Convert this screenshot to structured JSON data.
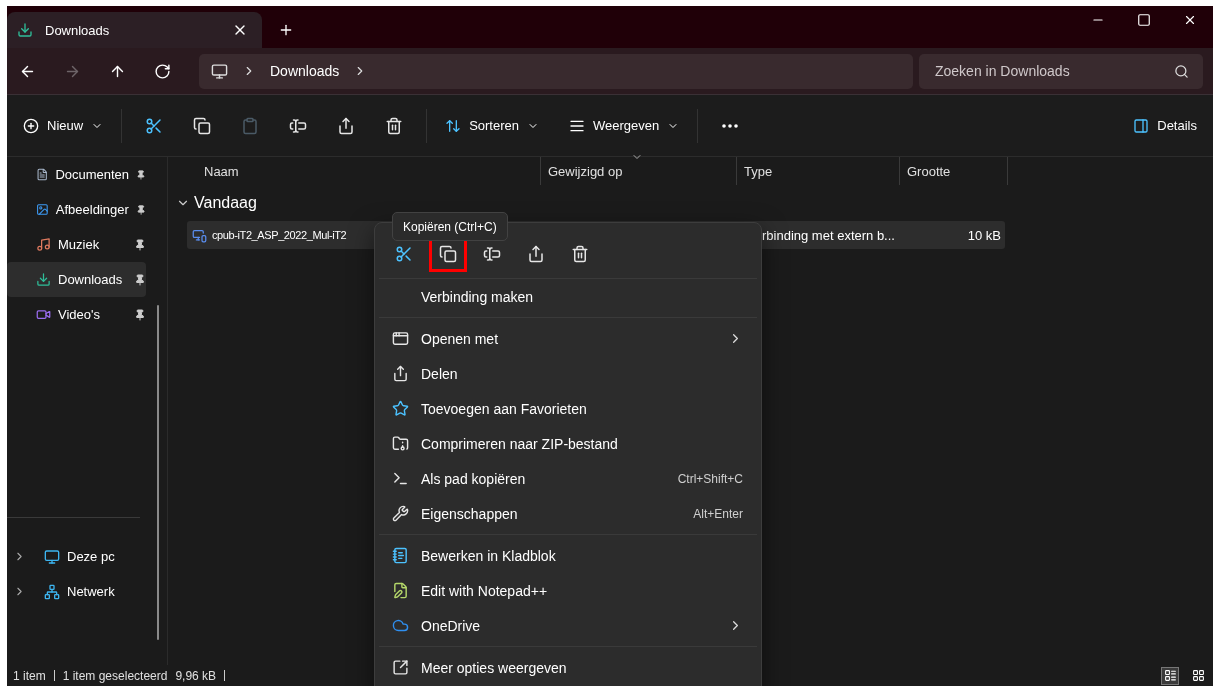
{
  "tab": {
    "title": "Downloads",
    "selected": true
  },
  "window_controls": [
    {
      "kind": "minimize"
    },
    {
      "kind": "maximize"
    },
    {
      "kind": "close"
    }
  ],
  "nav": [
    {
      "kind": "back",
      "disabled": false
    },
    {
      "kind": "forward",
      "disabled": true
    },
    {
      "kind": "up",
      "disabled": false
    },
    {
      "kind": "refresh",
      "disabled": false
    }
  ],
  "address": {
    "crumbs": [
      "Downloads"
    ]
  },
  "search": {
    "placeholder": "Zoeken in Downloads"
  },
  "toolbar": {
    "new_label": "Nieuw",
    "actions": [
      {
        "kind": "cut",
        "disabled": false
      },
      {
        "kind": "copy",
        "disabled": false
      },
      {
        "kind": "paste",
        "disabled": true
      },
      {
        "kind": "rename",
        "disabled": false
      },
      {
        "kind": "share",
        "disabled": false
      },
      {
        "kind": "delete",
        "disabled": false
      }
    ],
    "sort_label": "Sorteren",
    "view_label": "Weergeven",
    "details_label": "Details"
  },
  "sidebar": {
    "items": [
      {
        "label": "Documenten",
        "kind": "documents",
        "pinned": true,
        "selected": false
      },
      {
        "label": "Afbeeldinger",
        "kind": "pictures",
        "pinned": true,
        "selected": false
      },
      {
        "label": "Muziek",
        "kind": "music",
        "pinned": true,
        "selected": false
      },
      {
        "label": "Downloads",
        "kind": "downloads",
        "pinned": true,
        "selected": true
      },
      {
        "label": "Video's",
        "kind": "videos",
        "pinned": true,
        "selected": false
      }
    ],
    "locations": [
      {
        "label": "Deze pc",
        "kind": "pc",
        "expanded": false
      },
      {
        "label": "Netwerk",
        "kind": "network",
        "expanded": false
      }
    ]
  },
  "table": {
    "columns": [
      {
        "label": "Naam",
        "sorted": false
      },
      {
        "label": "Gewijzigd op",
        "sorted": true
      },
      {
        "label": "Type",
        "sorted": false
      },
      {
        "label": "Grootte",
        "sorted": false
      }
    ],
    "groups": [
      {
        "label": "Vandaag",
        "expanded": true,
        "rows": [
          {
            "name": "cpub-iT2_ASP_2022_Mul-iT2",
            "type": "rbinding met extern b...",
            "size": "10 kB",
            "selected": true
          }
        ]
      }
    ]
  },
  "context_menu": {
    "tooltip": "Kopiëren (Ctrl+C)",
    "actions": [
      {
        "kind": "cut",
        "highlighted": false
      },
      {
        "kind": "copy",
        "highlighted": true
      },
      {
        "kind": "rename",
        "highlighted": false
      },
      {
        "kind": "share",
        "highlighted": false
      },
      {
        "kind": "delete",
        "highlighted": false
      }
    ],
    "items": [
      {
        "kind": "plain",
        "label": "Verbinding maken",
        "submenu": false
      },
      {
        "kind": "divider"
      },
      {
        "kind": "open-with",
        "label": "Openen met",
        "submenu": true
      },
      {
        "kind": "share",
        "label": "Delen",
        "submenu": false
      },
      {
        "kind": "favorite",
        "label": "Toevoegen aan Favorieten",
        "submenu": false
      },
      {
        "kind": "zip",
        "label": "Comprimeren naar ZIP-bestand",
        "submenu": false
      },
      {
        "kind": "path",
        "label": "Als pad kopiëren",
        "shortcut": "Ctrl+Shift+C",
        "submenu": false
      },
      {
        "kind": "properties",
        "label": "Eigenschappen",
        "shortcut": "Alt+Enter",
        "submenu": false
      },
      {
        "kind": "divider"
      },
      {
        "kind": "notepad",
        "label": "Bewerken in Kladblok",
        "submenu": false
      },
      {
        "kind": "notepadpp",
        "label": "Edit with Notepad++",
        "submenu": false
      },
      {
        "kind": "cloud",
        "label": "OneDrive",
        "submenu": true
      },
      {
        "kind": "divider"
      },
      {
        "kind": "more",
        "label": "Meer opties weergeven",
        "submenu": false
      }
    ]
  },
  "status_bar": {
    "count": "1 item",
    "selection": "1 item geselecteerd",
    "size": "9,96 kB",
    "view_modes": [
      {
        "kind": "details",
        "selected": true
      },
      {
        "kind": "tiles",
        "selected": false
      }
    ]
  }
}
